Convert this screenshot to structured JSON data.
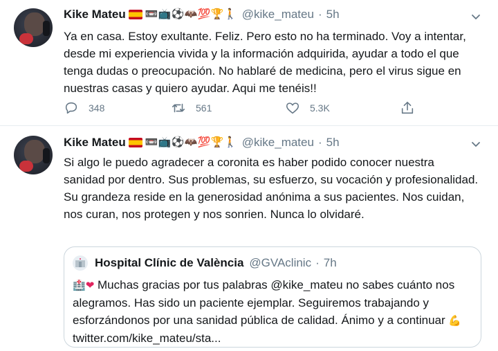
{
  "tweets": [
    {
      "author": "Kike Mateu",
      "handle": "@kike_mateu",
      "time": "5h",
      "text": "Ya en casa. Estoy exultante. Feliz. Pero esto no ha terminado. Voy a intentar, desde mi experiencia vivida y la información adquirida, ayudar a todo el que tenga dudas o preocupación. No hablaré de medicina, pero el virus sigue en nuestras casas y quiero ayudar. Aqui me tenéis!!",
      "replies": "348",
      "retweets": "561",
      "likes": "5.3K"
    },
    {
      "author": "Kike Mateu",
      "handle": "@kike_mateu",
      "time": "5h",
      "text": "Si algo le puedo agradecer a coronita es haber podido conocer nuestra sanidad por dentro. Sus problemas, su esfuerzo, su vocación y profesionalidad. Su grandeza reside en la generosidad anónima a sus pacientes. Nos cuidan, nos curan, nos protegen y nos sonrien. Nunca lo olvidaré."
    }
  ],
  "name_emojis": [
    "📼",
    "📺",
    "⚽",
    "🦇",
    "💯",
    "🏆",
    "🚶"
  ],
  "quote": {
    "author": "Hospital Clínic de València",
    "handle": "@GVAclinic",
    "time": "7h",
    "lead_emojis": [
      "🏥",
      "❤"
    ],
    "text": "Muchas gracias por tus palabras @kike_mateu no sabes cuánto nos alegramos. Has sido un paciente ejemplar. Seguiremos trabajando y esforzándonos por una sanidad pública de calidad. Ánimo y a continuar",
    "tail_emoji": "💪",
    "link": "twitter.com/kike_mateu/sta..."
  },
  "colors": {
    "text": "#14171a",
    "secondary": "#657786",
    "border": "#e6ecf0"
  },
  "icons": [
    "reply-icon",
    "retweet-icon",
    "like-icon",
    "share-icon",
    "caret-down-icon",
    "spain-flag-icon"
  ]
}
